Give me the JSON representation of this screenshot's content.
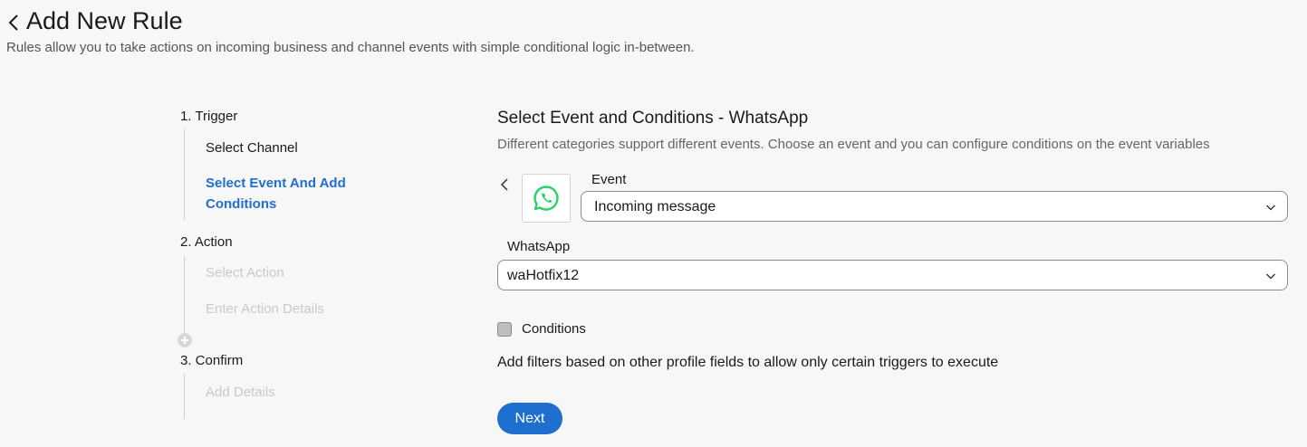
{
  "header": {
    "title": "Add New Rule",
    "subtitle": "Rules allow you to take actions on incoming business and channel events with simple conditional logic in-between."
  },
  "stepper": {
    "steps": [
      {
        "label": "1. Trigger",
        "substeps": [
          {
            "label": "Select Channel",
            "state": "done"
          },
          {
            "label": "Select Event And Add Conditions",
            "state": "active"
          }
        ]
      },
      {
        "label": "2. Action",
        "substeps": [
          {
            "label": "Select Action",
            "state": "pending"
          },
          {
            "label": "Enter Action Details",
            "state": "pending"
          }
        ]
      },
      {
        "label": "3. Confirm",
        "substeps": [
          {
            "label": "Add Details",
            "state": "pending"
          }
        ]
      }
    ]
  },
  "main": {
    "title": "Select Event and Conditions - WhatsApp",
    "description": "Different categories support different events. Choose an event and you can configure conditions on the event variables",
    "channel_icon": "whatsapp-icon",
    "event": {
      "label": "Event",
      "value": "Incoming message"
    },
    "account": {
      "label": "WhatsApp",
      "value": "waHotfix12"
    },
    "conditions": {
      "label": "Conditions",
      "checked": false
    },
    "hint": "Add filters based on other profile fields to allow only certain triggers to execute",
    "next_label": "Next"
  },
  "colors": {
    "accent": "#1f6fd1",
    "whatsapp": "#25d366",
    "pending_text": "#c9c9c9"
  }
}
